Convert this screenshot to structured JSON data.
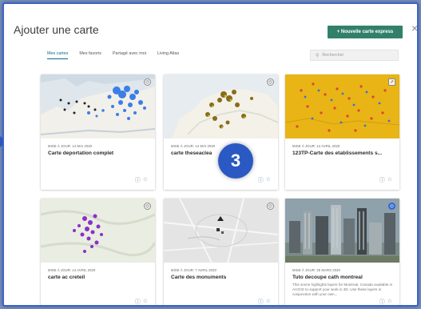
{
  "dialog": {
    "title": "Ajouter une carte",
    "new_map_button": "+ Nouvelle carte express",
    "close": "×"
  },
  "tabs": [
    "Mes cartes",
    "Mes favoris",
    "Partagé avec moi",
    "Living Atlas"
  ],
  "active_tab": "Mes cartes",
  "search": {
    "placeholder": "Rechercher",
    "value": ""
  },
  "step_badge": "3",
  "cards": [
    {
      "meta": "MISE À JOUR: 14 MAI 2020",
      "title": "Carte deportation complet",
      "description": "",
      "thumbnail": "europe-map-blue-points",
      "badge_icon": "globe-icon",
      "icons": [
        "info-icon",
        "star-icon"
      ]
    },
    {
      "meta": "MISE À JOUR: 14 MAI 2020",
      "title": "carte theseaclea",
      "description": "",
      "thumbnail": "europe-map-brown-markers",
      "badge_icon": "globe-icon",
      "icons": [
        "info-icon",
        "star-icon"
      ]
    },
    {
      "meta": "MISE À JOUR: 14 AVRIL 2020",
      "title": "123TP-Carte des etablissements s...",
      "description": "",
      "thumbnail": "yellow-map-colored-points",
      "badge_icon": "share-icon",
      "icons": [
        "info-icon",
        "star-icon"
      ]
    },
    {
      "meta": "MISE À JOUR: 14 AVRIL 2020",
      "title": "carte ac creteil",
      "description": "",
      "thumbnail": "region-map-purple-points",
      "badge_icon": "globe-icon",
      "icons": [
        "info-icon",
        "star-icon"
      ]
    },
    {
      "meta": "MISE À JOUR: 7 AVRIL 2020",
      "title": "Carte des monuments",
      "description": "",
      "thumbnail": "grey-city-map",
      "badge_icon": "globe-icon",
      "icons": [
        "info-icon",
        "star-icon"
      ]
    },
    {
      "meta": "MISE À JOUR: 25 MARS 2020",
      "title": "Tuto decoupe cath montreal",
      "description": "This scene highlights layers for Montreal, Canada available in ArcGIS to support your work in 3D. Use these layers in conjunction with your own...",
      "thumbnail": "3d-city-scene",
      "badge_icon": "globe-blue-icon",
      "icons": [
        "info-icon",
        "star-icon"
      ]
    }
  ],
  "colors": {
    "accent_green": "#33806a",
    "tab_active": "#0a6c80",
    "frame_blue": "#3f63c8",
    "step_badge": "#2a59c4"
  }
}
